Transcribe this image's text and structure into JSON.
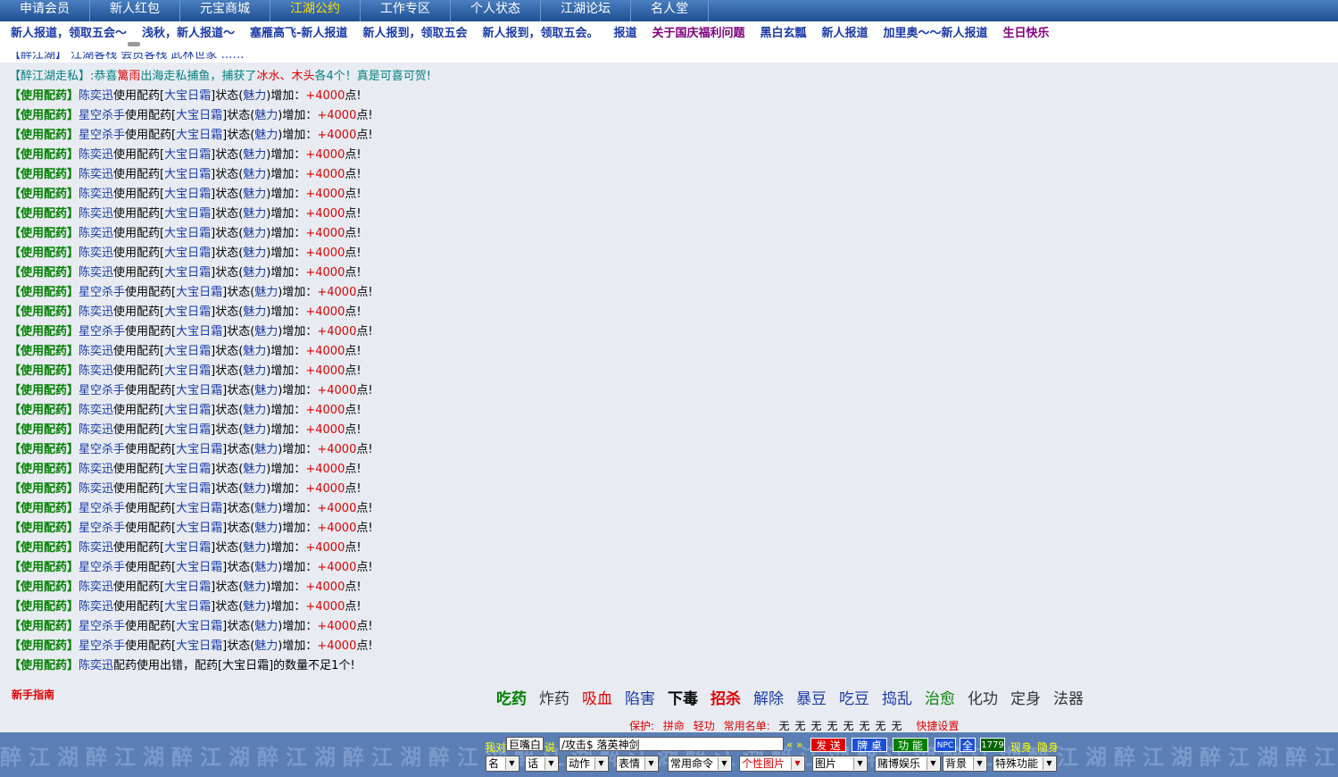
{
  "topnav": [
    "申请会员",
    "新人红包",
    "元宝商城",
    "江湖公约",
    "工作专区",
    "个人状态",
    "江湖论坛",
    "名人堂"
  ],
  "topnav_active": 3,
  "subnav": [
    {
      "t": "新人报道，领取五会～",
      "c": "blue"
    },
    {
      "t": "浅秋，新人报道～",
      "c": "blue"
    },
    {
      "t": "塞雁高飞-新人报道",
      "c": "blue"
    },
    {
      "t": "新人报到，领取五会",
      "c": "blue"
    },
    {
      "t": "新人报到，领取五会。",
      "c": "blue"
    },
    {
      "t": "报道",
      "c": "blue"
    },
    {
      "t": "关于国庆福利问题",
      "c": "purple"
    },
    {
      "t": "黑白玄瓢",
      "c": "blue"
    },
    {
      "t": "新人报道",
      "c": "blue"
    },
    {
      "t": "加里奥～～新人报道",
      "c": "blue"
    },
    {
      "t": "生日快乐",
      "c": "purple"
    }
  ],
  "first_row": {
    "tag": "【醉江湖走私】",
    "p1": ":恭喜",
    "who": "篱雨",
    "p2": "出海走私捕鱼，捕获了",
    "fish": "冰水、木头",
    "p3": "各4个！真是可喜可贺!"
  },
  "log": {
    "tag": "【使用配药】",
    "verb": "使用配药[",
    "item": "大宝日霜",
    "mid": "]状态(",
    "stat": "魅力",
    "mid2": ")增加：",
    "value": "+4000",
    "end": "点!",
    "names": [
      "陈奕迅",
      "星空杀手",
      "星空杀手",
      "陈奕迅",
      "陈奕迅",
      "陈奕迅",
      "陈奕迅",
      "陈奕迅",
      "陈奕迅",
      "陈奕迅",
      "星空杀手",
      "陈奕迅",
      "星空杀手",
      "陈奕迅",
      "陈奕迅",
      "星空杀手",
      "陈奕迅",
      "陈奕迅",
      "星空杀手",
      "陈奕迅",
      "陈奕迅",
      "星空杀手",
      "星空杀手",
      "陈奕迅",
      "星空杀手",
      "陈奕迅",
      "陈奕迅",
      "星空杀手",
      "星空杀手"
    ],
    "fail": {
      "name": "陈奕迅",
      "text": "配药使用出错，配药[大宝日霜]的数量不足1个!"
    }
  },
  "guide": "新手指南",
  "skills": [
    {
      "t": "吃药",
      "c": "#008000",
      "b": true
    },
    {
      "t": "炸药",
      "c": "#333333",
      "b": false
    },
    {
      "t": "吸血",
      "c": "#e00000",
      "b": false
    },
    {
      "t": "陷害",
      "c": "#1a3aa8",
      "b": false
    },
    {
      "t": "下毒",
      "c": "#000000",
      "b": true
    },
    {
      "t": "招杀",
      "c": "#e00000",
      "b": true
    },
    {
      "t": "解除",
      "c": "#1a3aa8",
      "b": false
    },
    {
      "t": "暴豆",
      "c": "#1a3aa8",
      "b": false
    },
    {
      "t": "吃豆",
      "c": "#1a3aa8",
      "b": false
    },
    {
      "t": "捣乱",
      "c": "#1a3aa8",
      "b": false
    },
    {
      "t": "治愈",
      "c": "#008000",
      "b": false
    },
    {
      "t": "化功",
      "c": "#333333",
      "b": false
    },
    {
      "t": "定身",
      "c": "#333333",
      "b": false
    },
    {
      "t": "法器",
      "c": "#333333",
      "b": false
    }
  ],
  "protect": {
    "label": "保护:",
    "items": [
      "拼命",
      "轻功"
    ],
    "common": "常用名单:",
    "none": [
      "无",
      "无",
      "无",
      "无",
      "无",
      "无",
      "无",
      "无"
    ],
    "quick": "快捷设置"
  },
  "chat": {
    "to_label": "我对",
    "target": "巨嘴白",
    "say_label": "说",
    "message": "/攻击$ 落英神剑",
    "arrows": "« »",
    "send": "发 送",
    "b1": "牌 桌",
    "b2": "功 能",
    "b3": "NPC",
    "b4": "全",
    "b5": "1779",
    "show": "现身",
    "hide": "隐身"
  },
  "selects": [
    "名",
    "话",
    "动作",
    "表情",
    "常用命令",
    "个性图片",
    "图片",
    "赌博娱乐",
    "背景",
    "特殊功能"
  ],
  "watermark": "醉江湖醉江湖醉江湖醉江湖醉江湖醉江湖醉江湖醉江湖醉江湖醉江湖醉江湖醉江湖醉江湖醉江湖醉江湖醉江湖醉江湖醉江湖醉江湖醉江湖"
}
